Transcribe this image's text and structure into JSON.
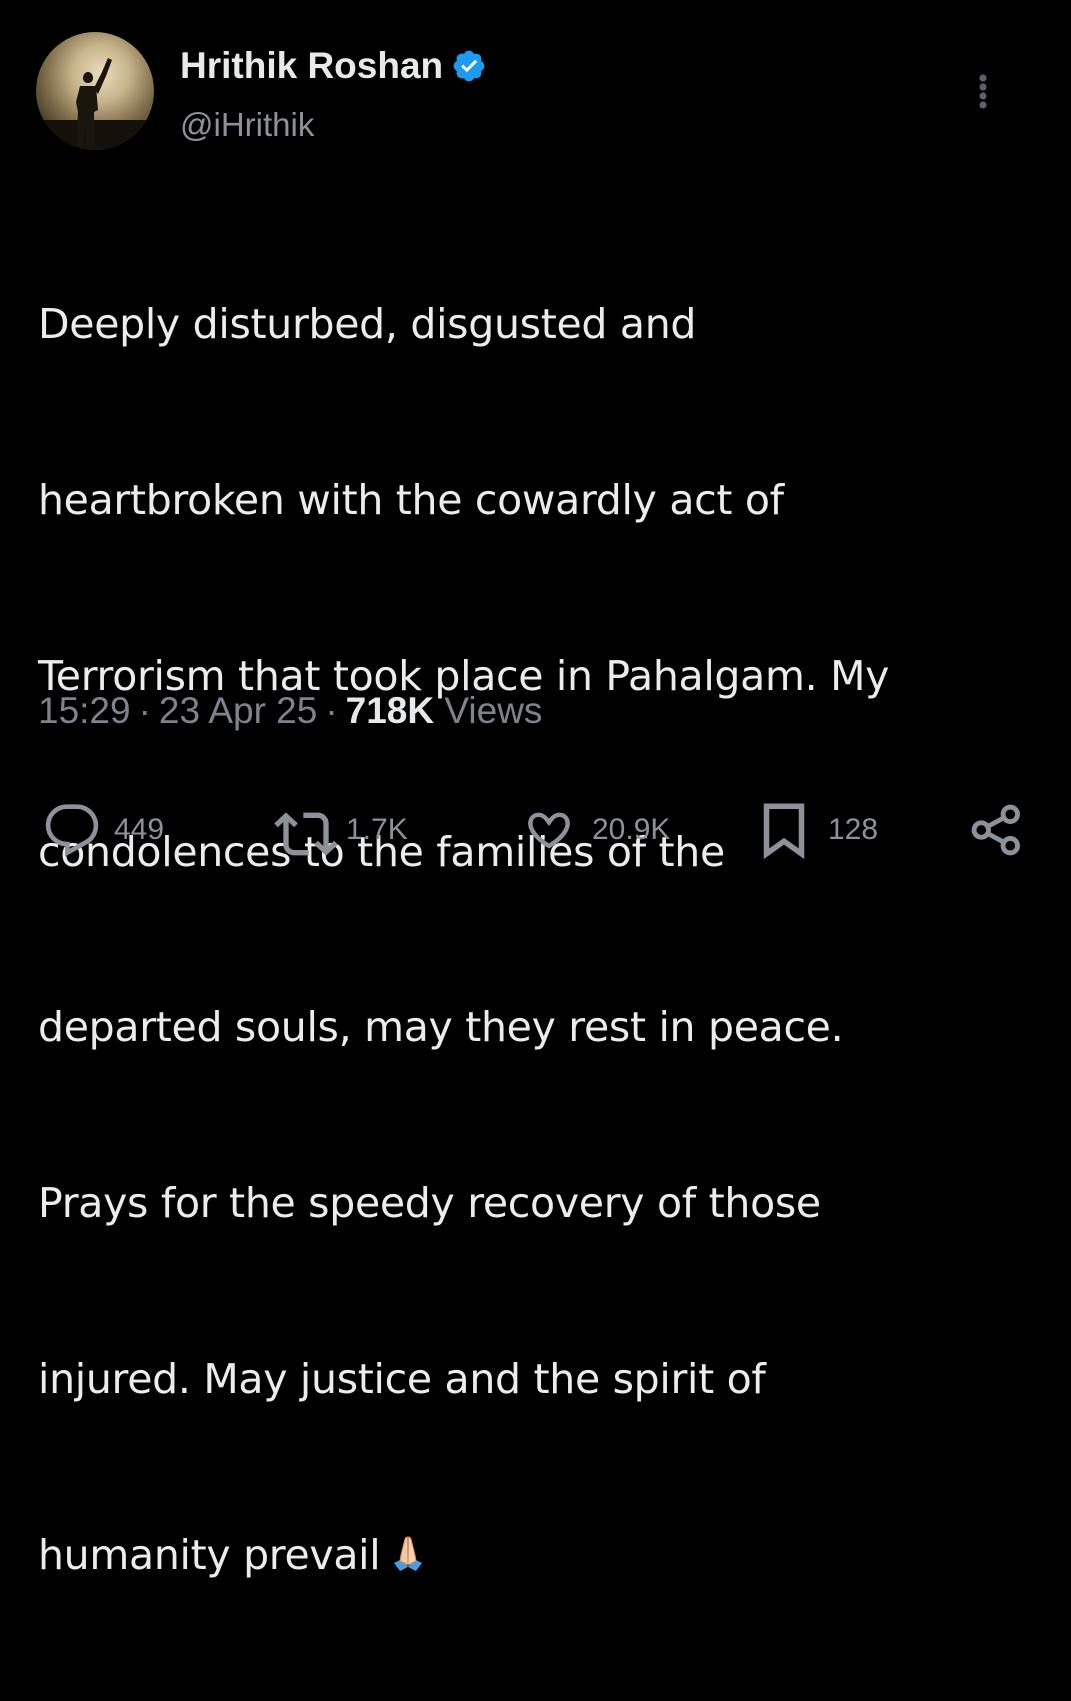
{
  "author": {
    "display_name": "Hrithik Roshan",
    "handle": "@iHrithik",
    "verified": true
  },
  "tweet": {
    "lines": [
      "Deeply disturbed, disgusted and",
      "heartbroken with the cowardly act of",
      "Terrorism that took place in Pahalgam. My",
      "condolences to the families of the",
      "departed souls, may they rest in peace.",
      "Prays for the speedy recovery of those",
      "injured. May justice and the spirit of",
      "humanity prevail"
    ],
    "emoji": "folded-hands"
  },
  "meta": {
    "time": "15:29",
    "separator": "·",
    "date": "23 Apr 25",
    "views_count": "718K",
    "views_label": "Views"
  },
  "actions": {
    "replies": "449",
    "reposts": "1.7K",
    "likes": "20.9K",
    "bookmarks": "128"
  },
  "icons": {
    "verified": "verified-badge-icon",
    "more": "more-vertical-icon",
    "reply": "reply-icon",
    "repost": "repost-icon",
    "like": "heart-icon",
    "bookmark": "bookmark-icon",
    "share": "share-icon"
  },
  "colors": {
    "background": "#000000",
    "text": "#e7e9ea",
    "muted": "#8b9299",
    "verified": "#1d9bf0"
  }
}
